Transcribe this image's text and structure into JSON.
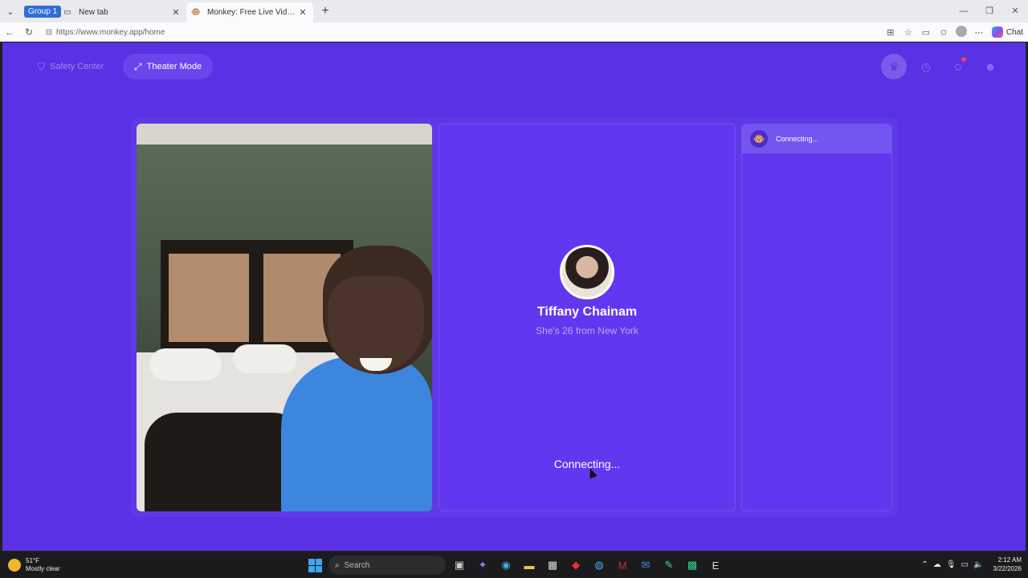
{
  "browser": {
    "group_label": "Group 1",
    "tabs": [
      {
        "title": "New tab",
        "favicon": "new-tab-icon"
      },
      {
        "title": "Monkey: Free Live Video Chat",
        "favicon": "monkey-icon"
      }
    ],
    "url": "https://www.monkey.app/home",
    "chat_label": "Chat"
  },
  "page": {
    "safety_center_label": "Safety Center",
    "theater_mode_label": "Theater Mode",
    "profile": {
      "name": "Tiffany Chainam",
      "subtitle": "She's 26 from New York"
    },
    "connecting_main": "Connecting...",
    "side_status": "Connecting..."
  },
  "colors": {
    "page_bg": "#5a31e4",
    "pane_bg": "#6337ef",
    "accent_text": "#b9a8f5"
  },
  "taskbar": {
    "weather_temp": "51°F",
    "weather_desc": "Mostly clear",
    "search_placeholder": "Search",
    "time": "2:12 AM",
    "date": "3/22/2026"
  }
}
